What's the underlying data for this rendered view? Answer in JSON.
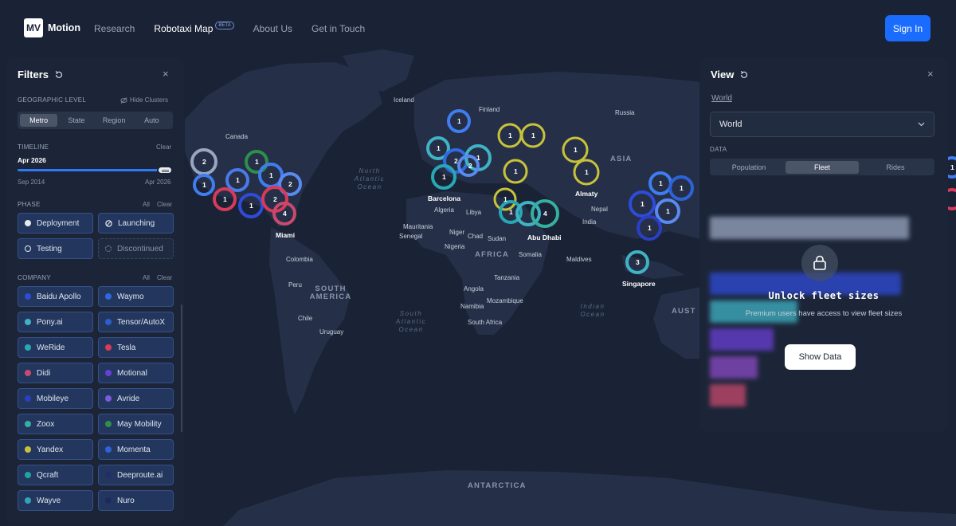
{
  "nav": {
    "logo_mark": "MV",
    "logo_text": "Motion",
    "links": [
      {
        "label": "Research"
      },
      {
        "label": "Robotaxi Map",
        "badge": "BETA"
      },
      {
        "label": "About Us"
      },
      {
        "label": "Get in Touch"
      }
    ],
    "sign_in": "Sign In"
  },
  "filters": {
    "title": "Filters",
    "geo": {
      "label": "GEOGRAPHIC LEVEL",
      "hide_clusters": "Hide Clusters",
      "options": [
        "Metro",
        "State",
        "Region",
        "Auto"
      ],
      "selected": "Metro"
    },
    "timeline": {
      "label": "TIMELINE",
      "clear": "Clear",
      "current": "Apr 2026",
      "start": "Sep 2014",
      "end": "Apr 2026",
      "position": 1.0
    },
    "phase": {
      "label": "PHASE",
      "all": "All",
      "clear": "Clear",
      "items": [
        "Deployment",
        "Launching",
        "Testing",
        "Discontinued"
      ]
    },
    "company": {
      "label": "COMPANY",
      "all": "All",
      "clear": "Clear",
      "items": [
        {
          "name": "Baidu Apollo",
          "color": "#2f4bd9"
        },
        {
          "name": "Waymo",
          "color": "#2d6ae0"
        },
        {
          "name": "Pony.ai",
          "color": "#3fb3c4"
        },
        {
          "name": "Tensor/AutoX",
          "color": "#2a5fd0"
        },
        {
          "name": "WeRide",
          "color": "#28a8b4"
        },
        {
          "name": "Tesla",
          "color": "#d83a5a"
        },
        {
          "name": "Didi",
          "color": "#c94a6e"
        },
        {
          "name": "Motional",
          "color": "#6a3fd6"
        },
        {
          "name": "Mobileye",
          "color": "#2b3fc4"
        },
        {
          "name": "Avride",
          "color": "#7a5ae0"
        },
        {
          "name": "Zoox",
          "color": "#35b0a0"
        },
        {
          "name": "May Mobility",
          "color": "#2e8f4a"
        },
        {
          "name": "Yandex",
          "color": "#c8c23a"
        },
        {
          "name": "Momenta",
          "color": "#2e63d8"
        },
        {
          "name": "Qcraft",
          "color": "#1fa59a"
        },
        {
          "name": "Deeproute.ai",
          "color": "#1e2f6a"
        },
        {
          "name": "Wayve",
          "color": "#2fa6b8"
        },
        {
          "name": "Nuro",
          "color": "#1c2a60"
        }
      ]
    }
  },
  "view": {
    "title": "View",
    "breadcrumb": "World",
    "select_value": "World",
    "data_label": "DATA",
    "tabs": [
      "Population",
      "Fleet",
      "Rides"
    ],
    "selected_tab": "Fleet",
    "lock_title": "Unlock fleet sizes",
    "lock_text": "Premium users have access to view fleet sizes",
    "show_button": "Show Data"
  },
  "map_labels": {
    "countries": [
      "Iceland",
      "Finland",
      "Russia",
      "Canada",
      "Algeria",
      "Libya",
      "Mauritania",
      "Senegal",
      "Niger",
      "Chad",
      "Sudan",
      "Nigeria",
      "Somalia",
      "Nepal",
      "India",
      "Maldives",
      "Colombia",
      "Peru",
      "Chile",
      "Uruguay",
      "Tanzania",
      "Angola",
      "Mozambique",
      "Namibia",
      "South Africa"
    ],
    "cities": [
      "Barcelona",
      "Almaty",
      "Abu Dhabi",
      "Miami",
      "Singapore"
    ],
    "oceans": [
      "North Atlantic Ocean",
      "South Atlantic Ocean",
      "Indian Ocean"
    ],
    "continents": [
      "ASIA",
      "AFRICA",
      "SOUTH AMERICA",
      "AUSTRALIA",
      "ANTARCTICA"
    ]
  },
  "clusters": [
    {
      "region": "north-america",
      "counts": [
        "2",
        "1",
        "1",
        "1",
        "1",
        "2",
        "1",
        "2",
        "1",
        "4"
      ]
    },
    {
      "region": "europe",
      "counts": [
        "1",
        "1",
        "2",
        "2",
        "1",
        "1"
      ]
    },
    {
      "region": "russia",
      "counts": [
        "1",
        "1",
        "1",
        "1"
      ]
    },
    {
      "region": "middle-east",
      "counts": [
        "1",
        "1",
        "1",
        "4"
      ]
    },
    {
      "region": "asia",
      "counts": [
        "1",
        "1",
        "1",
        "1",
        "1",
        "1",
        "3"
      ]
    }
  ]
}
